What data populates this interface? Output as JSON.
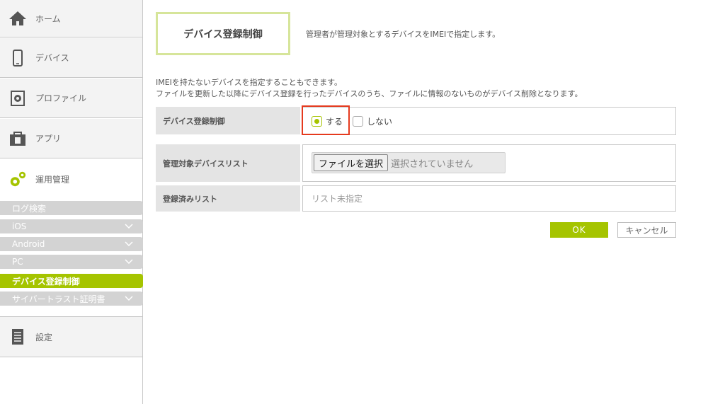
{
  "sidebar": {
    "home": "ホーム",
    "device": "デバイス",
    "profile": "プロファイル",
    "app": "アプリ",
    "ops": "運用管理",
    "settings": "設定",
    "subitems": [
      {
        "label": "ログ検索",
        "chevron": false,
        "active": false
      },
      {
        "label": "iOS",
        "chevron": true,
        "active": false
      },
      {
        "label": "Android",
        "chevron": true,
        "active": false
      },
      {
        "label": "PC",
        "chevron": true,
        "active": false
      },
      {
        "label": "デバイス登録制御",
        "chevron": false,
        "active": true
      },
      {
        "label": "サイバートラスト証明書",
        "chevron": true,
        "active": false
      }
    ]
  },
  "main": {
    "title": "デバイス登録制御",
    "title_desc": "管理者が管理対象とするデバイスをIMEIで指定します。",
    "desc_line1": "IMEIを持たないデバイスを指定することもできます。",
    "desc_line2": "ファイルを更新した以降にデバイス登録を行ったデバイスのうち、ファイルに情報のないものがデバイス削除となります。",
    "form": {
      "control_label": "デバイス登録制御",
      "radio_on": "する",
      "radio_off": "しない",
      "list_label": "管理対象デバイスリスト",
      "file_button": "ファイルを選択",
      "file_none": "選択されていません",
      "registered_label": "登録済みリスト",
      "registered_value": "リスト未指定"
    },
    "ok": "OK",
    "cancel": "キャンセル"
  },
  "colors": {
    "accent": "#a5c400",
    "highlight": "#e53a1e"
  }
}
